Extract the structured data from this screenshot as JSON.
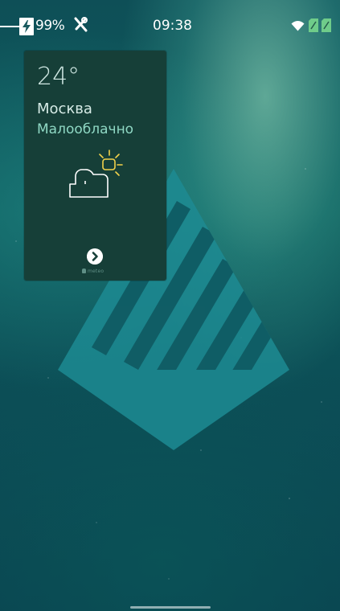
{
  "status_bar": {
    "battery_percent": "99%",
    "battery_level": 0.99,
    "charging_icon": "lightning-icon",
    "tools_icon": "tools-icon",
    "time": "09:38",
    "wifi_icon": "wifi-icon",
    "sim_icons": [
      "sim-card-icon",
      "sim-card-icon"
    ]
  },
  "weather_widget": {
    "temperature": "24°",
    "city": "Москва",
    "condition": "Малооблачно",
    "icon": "partly-cloudy-icon",
    "more_icon": "chevron-right-icon",
    "provider_prefix": "",
    "provider": "meteo",
    "background_color": "#163f38",
    "accent_color": "#8fd8c4"
  },
  "wallpaper": {
    "logo": "sailfish-os-logo",
    "colors": [
      "#0e4f57",
      "#0e5d5c",
      "#0a4350"
    ]
  }
}
